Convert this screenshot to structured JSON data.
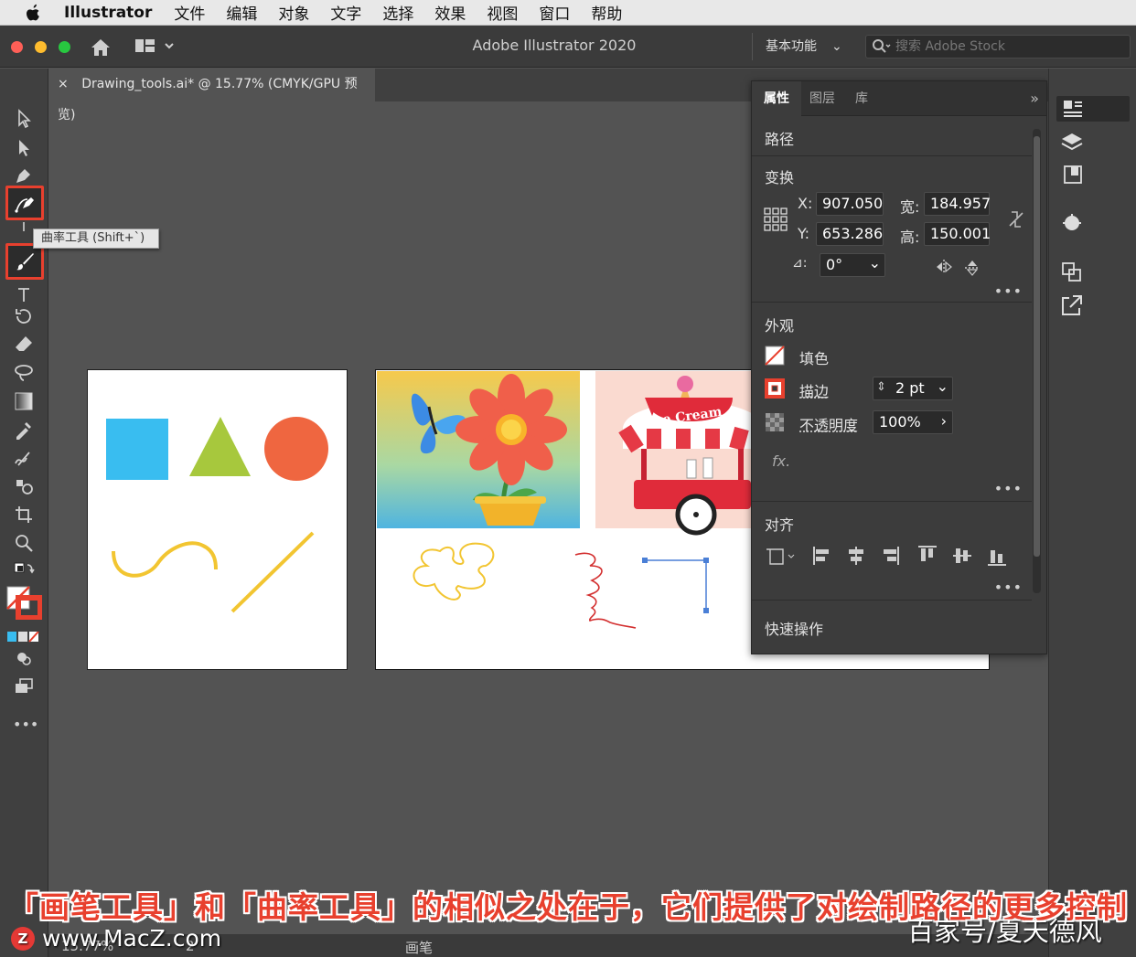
{
  "menubar": {
    "app_name": "Illustrator",
    "items": [
      "文件",
      "编辑",
      "对象",
      "文字",
      "选择",
      "效果",
      "视图",
      "窗口",
      "帮助"
    ]
  },
  "titlebar": {
    "title": "Adobe Illustrator 2020",
    "workspace": "基本功能",
    "stock_placeholder": "搜索 Adobe Stock"
  },
  "document_tab": {
    "close": "×",
    "label": "Drawing_tools.ai* @ 15.77% (CMYK/GPU 预览)"
  },
  "tooltip": "曲率工具 (Shift+`)",
  "toolbar": {
    "more": "•••"
  },
  "artwork": {
    "ice_cream_sign": "Ice Cream"
  },
  "panel": {
    "tabs": [
      "属性",
      "图层",
      "库"
    ],
    "collapse": "»",
    "object_type": "路径",
    "transform": {
      "title": "变换",
      "x_label": "X:",
      "x_value": "907.050",
      "y_label": "Y:",
      "y_value": "653.286",
      "w_label": "宽:",
      "w_value": "184.957",
      "h_label": "高:",
      "h_value": "150.001",
      "angle_label": "⊿:",
      "angle_value": "0°"
    },
    "appearance": {
      "title": "外观",
      "fill_label": "填色",
      "stroke_label": "描边",
      "stroke_value": "2 pt",
      "opacity_label": "不透明度",
      "opacity_value": "100%",
      "fx": "fx."
    },
    "align": {
      "title": "对齐"
    },
    "quick_actions": {
      "title": "快速操作"
    },
    "more": "•••"
  },
  "status": {
    "zoom": "15.77%",
    "page": "2",
    "tool": "画笔"
  },
  "overlay": {
    "caption": "「画笔工具」和「曲率工具」的相似之处在于，它们提供了对绘制路径的更多控制",
    "watermark_left": "www.MacZ.com",
    "watermark_left_badge": "Z",
    "watermark_right": "百家号/夏天德风"
  },
  "colors": {
    "highlight_red": "#e8402e",
    "square_blue": "#39bdf0",
    "triangle_green": "#a7c83d",
    "circle_orange": "#ef6640",
    "stroke_yellow": "#f2c531",
    "path_red": "#d32f2f",
    "selection_blue": "#4a7fd6"
  }
}
